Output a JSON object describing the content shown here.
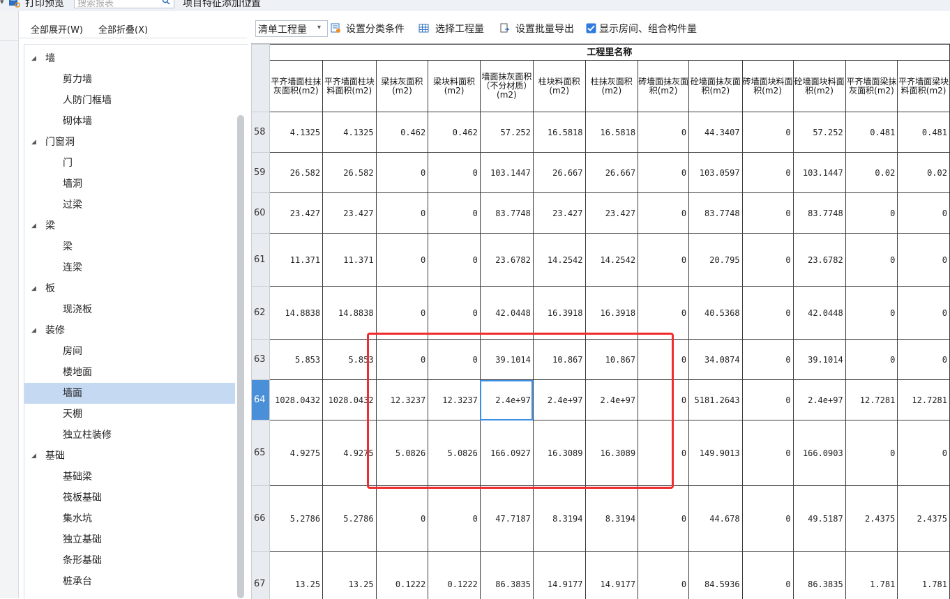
{
  "toolbar": {
    "print_preview": "打印预览",
    "search_placeholder": "搜索报表",
    "feature_position": "项目特征添加位置"
  },
  "tree_toolbar": {
    "expand_all": "全部展开(W)",
    "collapse_all": "全部折叠(X)"
  },
  "tree": [
    {
      "label": "墙",
      "type": "group"
    },
    {
      "label": "剪力墙",
      "type": "child"
    },
    {
      "label": "人防门框墙",
      "type": "child"
    },
    {
      "label": "砌体墙",
      "type": "child"
    },
    {
      "label": "门窗洞",
      "type": "group"
    },
    {
      "label": "门",
      "type": "child"
    },
    {
      "label": "墙洞",
      "type": "child"
    },
    {
      "label": "过梁",
      "type": "child"
    },
    {
      "label": "梁",
      "type": "group"
    },
    {
      "label": "梁",
      "type": "child"
    },
    {
      "label": "连梁",
      "type": "child"
    },
    {
      "label": "板",
      "type": "group"
    },
    {
      "label": "现浇板",
      "type": "child"
    },
    {
      "label": "装修",
      "type": "group"
    },
    {
      "label": "房间",
      "type": "child"
    },
    {
      "label": "楼地面",
      "type": "child"
    },
    {
      "label": "墙面",
      "type": "child",
      "selected": true
    },
    {
      "label": "天棚",
      "type": "child"
    },
    {
      "label": "独立柱装修",
      "type": "child"
    },
    {
      "label": "基础",
      "type": "group"
    },
    {
      "label": "基础梁",
      "type": "child"
    },
    {
      "label": "筏板基础",
      "type": "child"
    },
    {
      "label": "集水坑",
      "type": "child"
    },
    {
      "label": "独立基础",
      "type": "child"
    },
    {
      "label": "条形基础",
      "type": "child"
    },
    {
      "label": "桩承台",
      "type": "child"
    }
  ],
  "right_toolbar": {
    "mode_select": "清单工程量",
    "set_category": "设置分类条件",
    "select_quantity": "选择工程量",
    "batch_export": "设置批量导出",
    "show_rooms": "显示房间、组合构件量",
    "show_rooms_checked": true
  },
  "table": {
    "group_header": "工程里名称",
    "columns": [
      "平齐墙面柱抹灰面积(m2)",
      "平齐墙面柱块料面积(m2)",
      "梁抹灰面积(m2)",
      "梁块料面积(m2)",
      "墙面抹灰面积（不分材质）(m2)",
      "柱块料面积(m2)",
      "柱抹灰面积(m2)",
      "砖墙面抹灰面积(m2)",
      "砼墙面抹灰面积(m2)",
      "砖墙面块料面积(m2)",
      "砼墙面块料面积(m2)",
      "平齐墙面梁抹灰面积(m2)",
      "平齐墙面梁块料面积(m2)"
    ],
    "rows": [
      {
        "n": "58",
        "h": 58,
        "v": [
          "4.1325",
          "4.1325",
          "0.462",
          "0.462",
          "57.252",
          "16.5818",
          "16.5818",
          "0",
          "44.3407",
          "0",
          "57.252",
          "0.481",
          "0.481"
        ]
      },
      {
        "n": "59",
        "h": 58,
        "v": [
          "26.582",
          "26.582",
          "0",
          "0",
          "103.1447",
          "26.667",
          "26.667",
          "0",
          "103.0597",
          "0",
          "103.1447",
          "0.02",
          "0.02"
        ]
      },
      {
        "n": "60",
        "h": 58,
        "v": [
          "23.427",
          "23.427",
          "0",
          "0",
          "83.7748",
          "23.427",
          "23.427",
          "0",
          "83.7748",
          "0",
          "83.7748",
          "0",
          "0"
        ]
      },
      {
        "n": "61",
        "h": 76,
        "v": [
          "11.371",
          "11.371",
          "0",
          "0",
          "23.6782",
          "14.2542",
          "14.2542",
          "0",
          "20.795",
          "0",
          "23.6782",
          "0",
          "0"
        ]
      },
      {
        "n": "62",
        "h": 76,
        "v": [
          "14.8838",
          "14.8838",
          "0",
          "0",
          "42.0448",
          "16.3918",
          "16.3918",
          "0",
          "40.5368",
          "0",
          "42.0448",
          "0",
          "0"
        ]
      },
      {
        "n": "63",
        "h": 58,
        "v": [
          "5.853",
          "5.853",
          "0",
          "0",
          "39.1014",
          "10.867",
          "10.867",
          "0",
          "34.0874",
          "0",
          "39.1014",
          "0",
          "0"
        ]
      },
      {
        "n": "64",
        "h": 58,
        "active": true,
        "v": [
          "1028.0432",
          "1028.0432",
          "12.3237",
          "12.3237",
          "2.4e+97",
          "2.4e+97",
          "2.4e+97",
          "0",
          "5181.2643",
          "0",
          "2.4e+97",
          "12.7281",
          "12.7281"
        ]
      },
      {
        "n": "65",
        "h": 94,
        "v": [
          "4.9275",
          "4.9275",
          "5.0826",
          "5.0826",
          "166.0927",
          "16.3089",
          "16.3089",
          "0",
          "149.9013",
          "0",
          "166.0903",
          "0",
          "0"
        ]
      },
      {
        "n": "66",
        "h": 94,
        "v": [
          "5.2786",
          "5.2786",
          "0",
          "0",
          "47.7187",
          "8.3194",
          "8.3194",
          "0",
          "44.678",
          "0",
          "49.5187",
          "2.4375",
          "2.4375"
        ]
      },
      {
        "n": "67",
        "h": 94,
        "v": [
          "13.25",
          "13.25",
          "0.1222",
          "0.1222",
          "86.3835",
          "14.9177",
          "14.9177",
          "0",
          "84.5936",
          "0",
          "86.3835",
          "1.781",
          "1.781"
        ]
      }
    ],
    "selected_cell": {
      "row": "64",
      "col": 4
    }
  }
}
